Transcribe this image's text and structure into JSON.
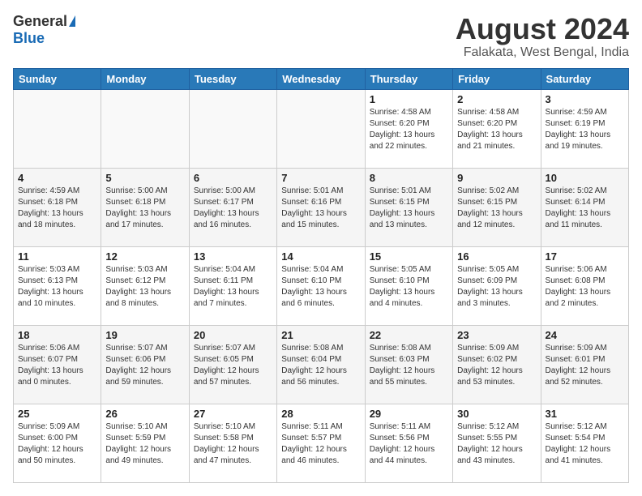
{
  "header": {
    "logo_general": "General",
    "logo_blue": "Blue",
    "month_year": "August 2024",
    "location": "Falakata, West Bengal, India"
  },
  "days_of_week": [
    "Sunday",
    "Monday",
    "Tuesday",
    "Wednesday",
    "Thursday",
    "Friday",
    "Saturday"
  ],
  "weeks": [
    [
      {
        "day": "",
        "info": ""
      },
      {
        "day": "",
        "info": ""
      },
      {
        "day": "",
        "info": ""
      },
      {
        "day": "",
        "info": ""
      },
      {
        "day": "1",
        "info": "Sunrise: 4:58 AM\nSunset: 6:20 PM\nDaylight: 13 hours\nand 22 minutes."
      },
      {
        "day": "2",
        "info": "Sunrise: 4:58 AM\nSunset: 6:20 PM\nDaylight: 13 hours\nand 21 minutes."
      },
      {
        "day": "3",
        "info": "Sunrise: 4:59 AM\nSunset: 6:19 PM\nDaylight: 13 hours\nand 19 minutes."
      }
    ],
    [
      {
        "day": "4",
        "info": "Sunrise: 4:59 AM\nSunset: 6:18 PM\nDaylight: 13 hours\nand 18 minutes."
      },
      {
        "day": "5",
        "info": "Sunrise: 5:00 AM\nSunset: 6:18 PM\nDaylight: 13 hours\nand 17 minutes."
      },
      {
        "day": "6",
        "info": "Sunrise: 5:00 AM\nSunset: 6:17 PM\nDaylight: 13 hours\nand 16 minutes."
      },
      {
        "day": "7",
        "info": "Sunrise: 5:01 AM\nSunset: 6:16 PM\nDaylight: 13 hours\nand 15 minutes."
      },
      {
        "day": "8",
        "info": "Sunrise: 5:01 AM\nSunset: 6:15 PM\nDaylight: 13 hours\nand 13 minutes."
      },
      {
        "day": "9",
        "info": "Sunrise: 5:02 AM\nSunset: 6:15 PM\nDaylight: 13 hours\nand 12 minutes."
      },
      {
        "day": "10",
        "info": "Sunrise: 5:02 AM\nSunset: 6:14 PM\nDaylight: 13 hours\nand 11 minutes."
      }
    ],
    [
      {
        "day": "11",
        "info": "Sunrise: 5:03 AM\nSunset: 6:13 PM\nDaylight: 13 hours\nand 10 minutes."
      },
      {
        "day": "12",
        "info": "Sunrise: 5:03 AM\nSunset: 6:12 PM\nDaylight: 13 hours\nand 8 minutes."
      },
      {
        "day": "13",
        "info": "Sunrise: 5:04 AM\nSunset: 6:11 PM\nDaylight: 13 hours\nand 7 minutes."
      },
      {
        "day": "14",
        "info": "Sunrise: 5:04 AM\nSunset: 6:10 PM\nDaylight: 13 hours\nand 6 minutes."
      },
      {
        "day": "15",
        "info": "Sunrise: 5:05 AM\nSunset: 6:10 PM\nDaylight: 13 hours\nand 4 minutes."
      },
      {
        "day": "16",
        "info": "Sunrise: 5:05 AM\nSunset: 6:09 PM\nDaylight: 13 hours\nand 3 minutes."
      },
      {
        "day": "17",
        "info": "Sunrise: 5:06 AM\nSunset: 6:08 PM\nDaylight: 13 hours\nand 2 minutes."
      }
    ],
    [
      {
        "day": "18",
        "info": "Sunrise: 5:06 AM\nSunset: 6:07 PM\nDaylight: 13 hours\nand 0 minutes."
      },
      {
        "day": "19",
        "info": "Sunrise: 5:07 AM\nSunset: 6:06 PM\nDaylight: 12 hours\nand 59 minutes."
      },
      {
        "day": "20",
        "info": "Sunrise: 5:07 AM\nSunset: 6:05 PM\nDaylight: 12 hours\nand 57 minutes."
      },
      {
        "day": "21",
        "info": "Sunrise: 5:08 AM\nSunset: 6:04 PM\nDaylight: 12 hours\nand 56 minutes."
      },
      {
        "day": "22",
        "info": "Sunrise: 5:08 AM\nSunset: 6:03 PM\nDaylight: 12 hours\nand 55 minutes."
      },
      {
        "day": "23",
        "info": "Sunrise: 5:09 AM\nSunset: 6:02 PM\nDaylight: 12 hours\nand 53 minutes."
      },
      {
        "day": "24",
        "info": "Sunrise: 5:09 AM\nSunset: 6:01 PM\nDaylight: 12 hours\nand 52 minutes."
      }
    ],
    [
      {
        "day": "25",
        "info": "Sunrise: 5:09 AM\nSunset: 6:00 PM\nDaylight: 12 hours\nand 50 minutes."
      },
      {
        "day": "26",
        "info": "Sunrise: 5:10 AM\nSunset: 5:59 PM\nDaylight: 12 hours\nand 49 minutes."
      },
      {
        "day": "27",
        "info": "Sunrise: 5:10 AM\nSunset: 5:58 PM\nDaylight: 12 hours\nand 47 minutes."
      },
      {
        "day": "28",
        "info": "Sunrise: 5:11 AM\nSunset: 5:57 PM\nDaylight: 12 hours\nand 46 minutes."
      },
      {
        "day": "29",
        "info": "Sunrise: 5:11 AM\nSunset: 5:56 PM\nDaylight: 12 hours\nand 44 minutes."
      },
      {
        "day": "30",
        "info": "Sunrise: 5:12 AM\nSunset: 5:55 PM\nDaylight: 12 hours\nand 43 minutes."
      },
      {
        "day": "31",
        "info": "Sunrise: 5:12 AM\nSunset: 5:54 PM\nDaylight: 12 hours\nand 41 minutes."
      }
    ]
  ]
}
